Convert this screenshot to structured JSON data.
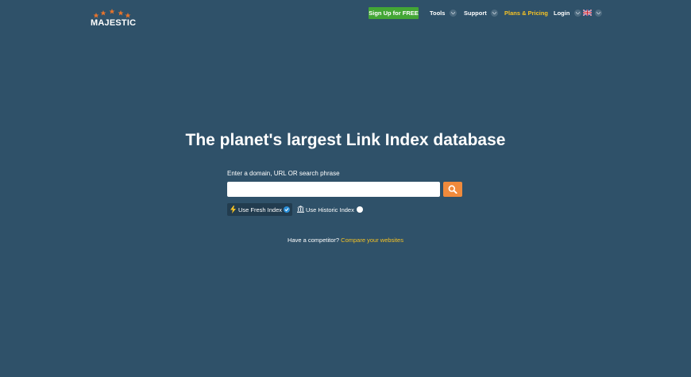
{
  "header": {
    "logo_text": "MAJESTIC",
    "signup_label": "Sign Up for FREE",
    "nav": {
      "tools": "Tools",
      "support": "Support",
      "plans": "Plans & Pricing",
      "login": "Login"
    },
    "language_flag": "uk-flag-icon"
  },
  "hero": {
    "title": "The planet's largest Link Index database",
    "search_label": "Enter a domain, URL OR search phrase",
    "search_value": "",
    "search_placeholder": "",
    "fresh_index_label": "Use Fresh Index",
    "historic_index_label": "Use Historic Index",
    "fresh_selected": true,
    "competitor_text": "Have a competitor?",
    "compare_link": "Compare your websites"
  },
  "colors": {
    "background": "#2f5169",
    "signup_green": "#43a635",
    "accent_yellow": "#f5c225",
    "search_button_orange": "#f08a3c",
    "toggle_blue": "#2a8fd8"
  },
  "icons": [
    "stars-logo-icon",
    "chevron-down-icon",
    "uk-flag-icon",
    "search-icon",
    "lightning-icon",
    "bank-icon",
    "check-icon"
  ]
}
